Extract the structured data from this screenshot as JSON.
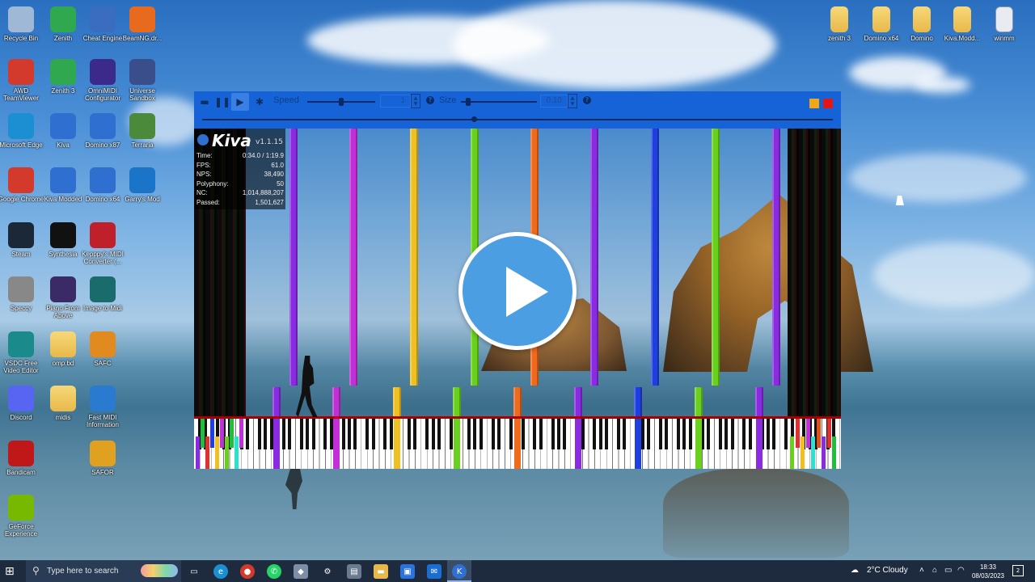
{
  "desktop": {
    "icons_left": [
      {
        "label": "Recycle Bin",
        "icon": "recycle-bin-icon",
        "color": "#9fb8d6"
      },
      {
        "label": "Zenith",
        "icon": "zenith-icon",
        "color": "#2fa84f"
      },
      {
        "label": "Cheat Engine",
        "icon": "cheat-engine-icon",
        "color": "#3a6cc0"
      },
      {
        "label": "BeamNG.dr...",
        "icon": "beamng-icon",
        "color": "#e86a1e"
      },
      {
        "label": "AWD TeamViewer",
        "icon": "chrome-icon",
        "color": "#d33a2c"
      },
      {
        "label": "Zenith 3",
        "icon": "zenith-icon",
        "color": "#2fa84f"
      },
      {
        "label": "OmniMIDI Configurator",
        "icon": "omnimidi-icon",
        "color": "#3b2a8a"
      },
      {
        "label": "Universe Sandbox",
        "icon": "universe-sandbox-icon",
        "color": "#3a4e8c"
      },
      {
        "label": "Microsoft Edge",
        "icon": "edge-icon",
        "color": "#1b8fd2"
      },
      {
        "label": "Kiva",
        "icon": "kiva-icon",
        "color": "#2e6fd0"
      },
      {
        "label": "Domino x87",
        "icon": "domino-icon",
        "color": "#2e6fd0"
      },
      {
        "label": "Terraria",
        "icon": "terraria-icon",
        "color": "#4a8a3a"
      },
      {
        "label": "Google Chrome",
        "icon": "chrome-icon",
        "color": "#d33a2c"
      },
      {
        "label": "Kiva Modded",
        "icon": "kiva-icon",
        "color": "#2e6fd0"
      },
      {
        "label": "Domino x64",
        "icon": "domino-icon",
        "color": "#2e6fd0"
      },
      {
        "label": "Garry's Mod",
        "icon": "garrys-mod-icon",
        "color": "#1a74c8"
      },
      {
        "label": "Steam",
        "icon": "steam-icon",
        "color": "#1b2838"
      },
      {
        "label": "Synthesia",
        "icon": "synthesia-icon",
        "color": "#111111"
      },
      {
        "label": "Kepppy's MIDI Converter (...",
        "icon": "kmc-icon",
        "color": "#c0202a"
      },
      {
        "label": "Speccy",
        "icon": "speccy-icon",
        "color": "#888888"
      },
      {
        "label": "Piano From Above",
        "icon": "piano-icon",
        "color": "#3a2a66"
      },
      {
        "label": "Image to Midi",
        "icon": "image-to-midi-icon",
        "color": "#1a6b6b"
      },
      {
        "label": "VSDC Free Video Editor",
        "icon": "vsdc-icon",
        "color": "#1a8a8a"
      },
      {
        "label": "omp.bd",
        "icon": "folder-icon",
        "color": "#e8b94a"
      },
      {
        "label": "SAFC",
        "icon": "safc-icon",
        "color": "#e08a20"
      },
      {
        "label": "Discord",
        "icon": "discord-icon",
        "color": "#5865f2"
      },
      {
        "label": "midis",
        "icon": "folder-icon",
        "color": "#e8b94a"
      },
      {
        "label": "Fast MIDI Information",
        "icon": "fast-midi-icon",
        "color": "#2a7ad0"
      },
      {
        "label": "Bandicam",
        "icon": "bandicam-icon",
        "color": "#c01818"
      },
      {
        "label": "SAFOR",
        "icon": "safor-icon",
        "color": "#e0a020"
      },
      {
        "label": "GeForce Experience",
        "icon": "geforce-icon",
        "color": "#76b900"
      }
    ],
    "icons_right": [
      {
        "label": "zenith 3",
        "icon": "folder-icon"
      },
      {
        "label": "Domino x64",
        "icon": "folder-icon"
      },
      {
        "label": "Domino",
        "icon": "folder-icon"
      },
      {
        "label": "Kiva.Modd...",
        "icon": "folder-icon"
      },
      {
        "label": "winmm",
        "icon": "file-icon"
      }
    ]
  },
  "kiva": {
    "toolbar": {
      "speed_label": "Speed",
      "speed_value": "1",
      "size_label": "Size",
      "size_value": "0.10"
    },
    "title": "Kiva",
    "version": "v1.1.15",
    "stats": [
      {
        "label": "Time:",
        "value": "0:34.0 / 1:19.9"
      },
      {
        "label": "FPS:",
        "value": "61.0"
      },
      {
        "label": "NPS:",
        "value": "38,490"
      },
      {
        "label": "Polyphony:",
        "value": "50"
      },
      {
        "label": "NC:",
        "value": "1,014,888,207"
      },
      {
        "label": "Passed:",
        "value": "1,501,627"
      }
    ],
    "seek_progress": 0.43,
    "note_colors": [
      "#8a2be2",
      "#c12fd6",
      "#f0c020",
      "#6ad01e",
      "#ef6a1c",
      "#8a2be2",
      "#1f3fe0",
      "#6ad01e",
      "#8a2be2"
    ]
  },
  "taskbar": {
    "search_placeholder": "Type here to search",
    "weather": "2°C  Cloudy",
    "time": "18:33",
    "date": "08/03/2023",
    "notification_count": "2"
  }
}
